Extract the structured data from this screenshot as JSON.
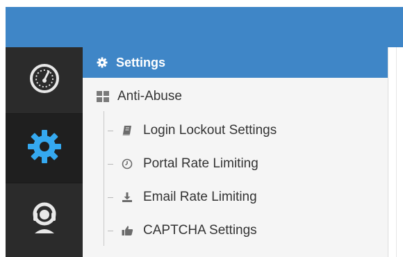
{
  "colors": {
    "accent": "#3f86c7",
    "iconbar_bg": "#2b2b2b",
    "active_gear": "#35a9f0",
    "submenu_bg": "#f5f5f5",
    "text": "#333333"
  },
  "iconbar": {
    "items": [
      {
        "icon": "dashboard-gauge-icon",
        "active": false
      },
      {
        "icon": "gear-icon",
        "active": true
      },
      {
        "icon": "support-headset-icon",
        "active": false
      }
    ]
  },
  "submenu": {
    "header": {
      "icon": "gear-icon",
      "label": "Settings"
    },
    "group": {
      "icon": "grid-icon",
      "label": "Anti-Abuse"
    },
    "items": [
      {
        "icon": "book-icon",
        "label": "Login Lockout Settings"
      },
      {
        "icon": "clock-icon",
        "label": "Portal Rate Limiting"
      },
      {
        "icon": "download-icon",
        "label": "Email Rate Limiting"
      },
      {
        "icon": "thumbs-up-icon",
        "label": "CAPTCHA Settings"
      }
    ]
  }
}
